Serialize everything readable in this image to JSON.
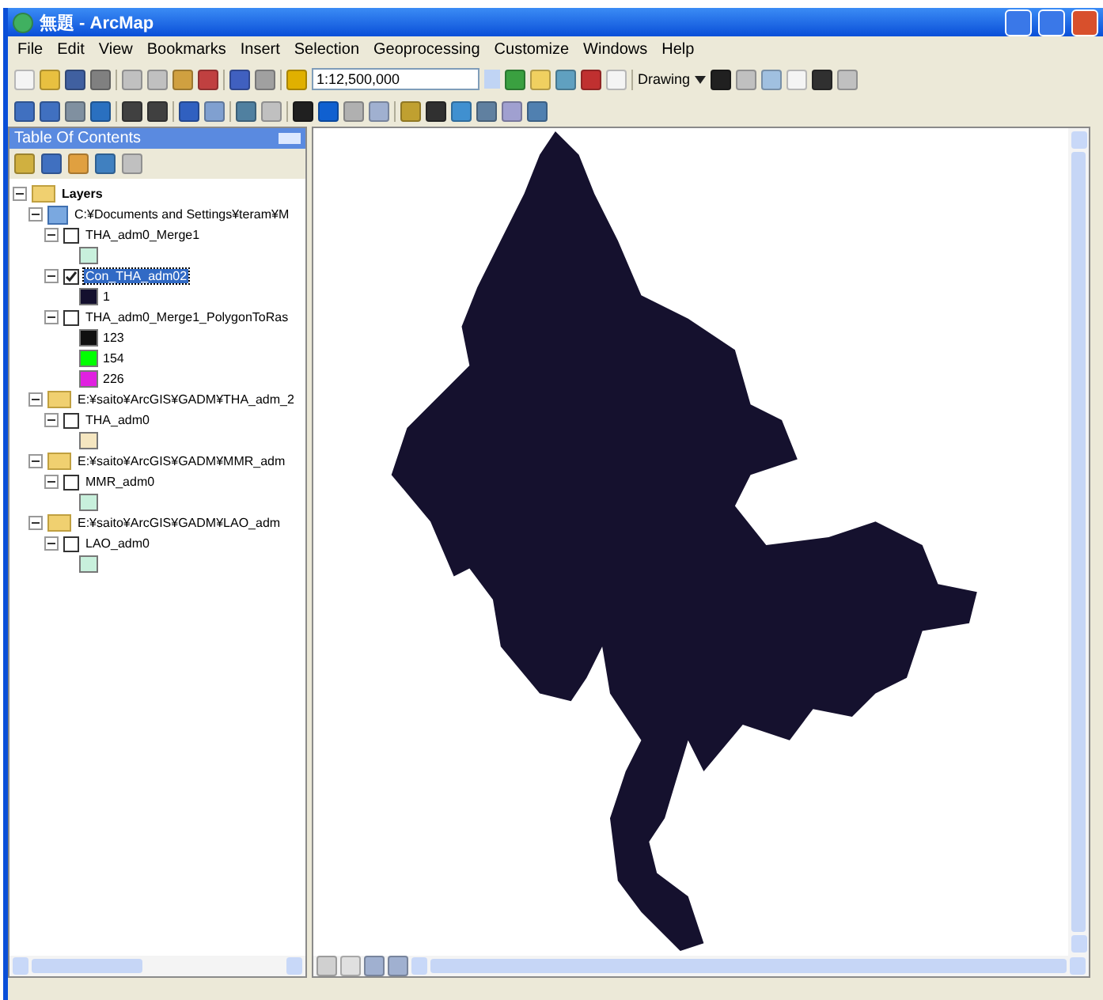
{
  "window": {
    "title": "無題 - ArcMap"
  },
  "menu": [
    "File",
    "Edit",
    "View",
    "Bookmarks",
    "Insert",
    "Selection",
    "Geoprocessing",
    "Customize",
    "Windows",
    "Help"
  ],
  "toolbar": {
    "scale": "1:12,500,000",
    "drawing_menu": "Drawing"
  },
  "toc": {
    "title": "Table Of Contents",
    "tree": [
      {
        "kind": "frame",
        "label": "Layers",
        "expanded": true,
        "children": [
          {
            "kind": "group",
            "label": "C:¥Documents and Settings¥teram¥M",
            "expanded": true,
            "children": [
              {
                "kind": "layer",
                "label": "THA_adm0_Merge1",
                "checked": false,
                "selected": false,
                "expanded": true,
                "legend": [
                  {
                    "color": "#c8f0dc"
                  }
                ]
              },
              {
                "kind": "layer",
                "label": "Con_THA_adm02",
                "checked": true,
                "selected": true,
                "expanded": true,
                "legend": [
                  {
                    "label": "1",
                    "color": "#14102e"
                  }
                ]
              },
              {
                "kind": "layer",
                "label": "THA_adm0_Merge1_PolygonToRas",
                "checked": false,
                "selected": false,
                "expanded": true,
                "legend": [
                  {
                    "label": "123",
                    "color": "#101010"
                  },
                  {
                    "label": "154",
                    "color": "#00ff00"
                  },
                  {
                    "label": "226",
                    "color": "#e020e0"
                  }
                ]
              }
            ]
          },
          {
            "kind": "folder",
            "label": "E:¥saito¥ArcGIS¥GADM¥THA_adm_2",
            "expanded": true,
            "children": [
              {
                "kind": "layer",
                "label": "THA_adm0",
                "checked": false,
                "selected": false,
                "expanded": true,
                "legend": [
                  {
                    "color": "#f5e6c0"
                  }
                ]
              }
            ]
          },
          {
            "kind": "folder",
            "label": "E:¥saito¥ArcGIS¥GADM¥MMR_adm",
            "expanded": true,
            "children": [
              {
                "kind": "layer",
                "label": "MMR_adm0",
                "checked": false,
                "selected": false,
                "expanded": true,
                "legend": [
                  {
                    "color": "#c8f0dc"
                  }
                ]
              }
            ]
          },
          {
            "kind": "folder",
            "label": "E:¥saito¥ArcGIS¥GADM¥LAO_adm",
            "expanded": true,
            "children": [
              {
                "kind": "layer",
                "label": "LAO_adm0",
                "checked": false,
                "selected": false,
                "expanded": true,
                "legend": [
                  {
                    "color": "#c8f0dc"
                  }
                ]
              }
            ]
          }
        ]
      }
    ]
  }
}
